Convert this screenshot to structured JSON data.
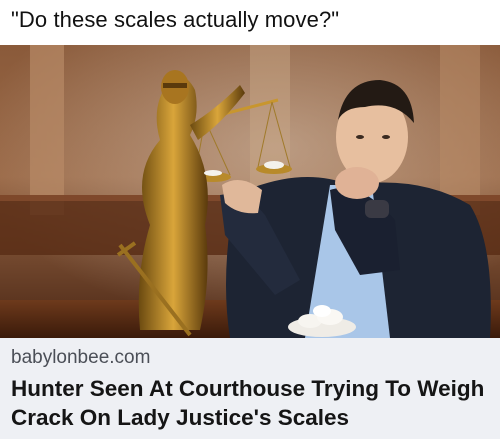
{
  "post": {
    "caption": "\"Do these scales actually move?\""
  },
  "link_card": {
    "domain": "babylonbee.com",
    "headline": "Hunter Seen At Courthouse Trying To Weigh Crack On Lady Justice's Scales"
  },
  "colors": {
    "footer_bg": "#eef0f4",
    "statue_gold": "#b8860b",
    "room_wood": "#6b3a1f",
    "jacket": "#1d2433",
    "shirt": "#a9c6e8"
  }
}
